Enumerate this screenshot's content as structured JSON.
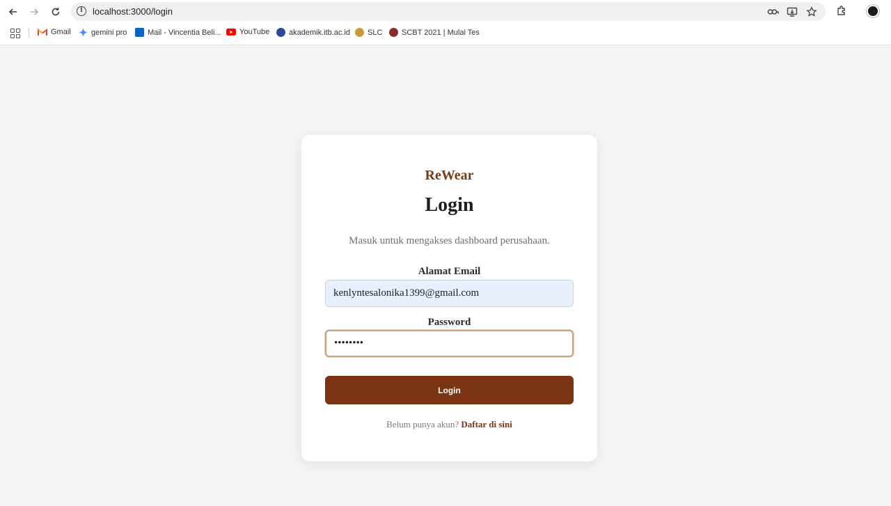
{
  "browser": {
    "url": "localhost:3000/login",
    "bookmarks": [
      {
        "label": "Gmail",
        "icon": "gmail-icon",
        "color": "#ea4335"
      },
      {
        "label": "gemini pro",
        "icon": "gemini-icon",
        "color": "#4285f4"
      },
      {
        "label": "Mail - Vincentia Beli...",
        "icon": "outlook-icon",
        "color": "#0a64c8"
      },
      {
        "label": "YouTube",
        "icon": "youtube-icon",
        "color": "#ff0000"
      },
      {
        "label": "akademik.itb.ac.id",
        "icon": "itb-icon",
        "color": "#2b4c9b"
      },
      {
        "label": "SLC",
        "icon": "slc-icon",
        "color": "#c79a3c"
      },
      {
        "label": "SCBT 2021 | Mulai Tes",
        "icon": "scbt-icon",
        "color": "#8a2a2a"
      }
    ]
  },
  "login": {
    "brand": "ReWear",
    "title": "Login",
    "subtitle": "Masuk untuk mengakses dashboard perusahaan.",
    "email_label": "Alamat Email",
    "email_value": "kenlyntesalonika1399@gmail.com",
    "password_label": "Password",
    "password_value": "••••••••",
    "button_label": "Login",
    "signup_prompt": "Belum punya akun?",
    "signup_link": "Daftar di sini"
  },
  "colors": {
    "brand": "#7b3a14",
    "button": "#7b3512",
    "background": "#f4f4f2"
  }
}
